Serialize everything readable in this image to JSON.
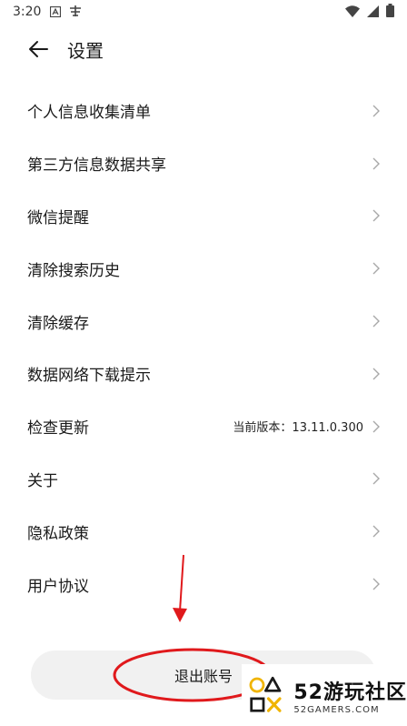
{
  "status_bar": {
    "time": "3:20"
  },
  "header": {
    "title": "设置"
  },
  "settings": {
    "items": [
      {
        "label": "个人信息收集清单",
        "value": ""
      },
      {
        "label": "第三方信息数据共享",
        "value": ""
      },
      {
        "label": "微信提醒",
        "value": ""
      },
      {
        "label": "清除搜索历史",
        "value": ""
      },
      {
        "label": "清除缓存",
        "value": ""
      },
      {
        "label": "数据网络下载提示",
        "value": ""
      },
      {
        "label": "检查更新",
        "value": "当前版本：13.11.0.300"
      },
      {
        "label": "关于",
        "value": ""
      },
      {
        "label": "隐私政策",
        "value": ""
      },
      {
        "label": "用户协议",
        "value": ""
      }
    ]
  },
  "logout": {
    "label": "退出账号"
  },
  "annotation": {
    "color": "#e0191c"
  },
  "watermark": {
    "title": "52游玩社区",
    "subtitle": "52GAMERS.COM"
  }
}
